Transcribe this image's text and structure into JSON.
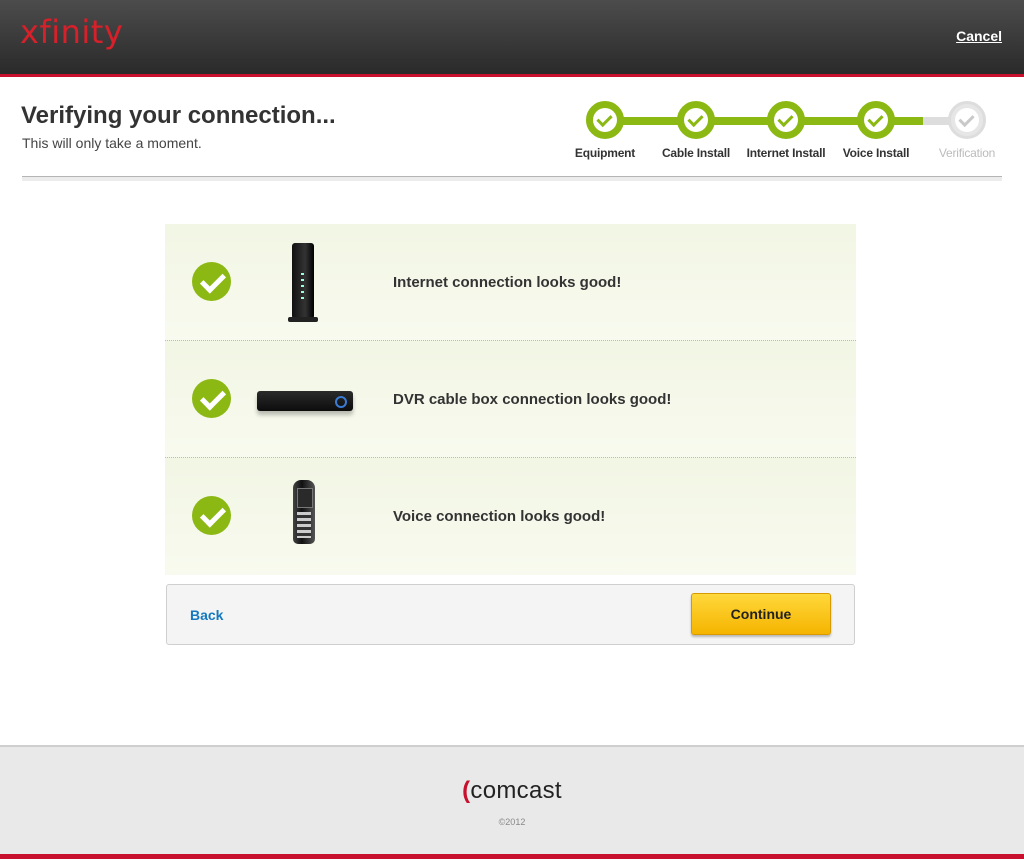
{
  "header": {
    "logo_text": "xfinity",
    "cancel_label": "Cancel"
  },
  "page": {
    "title": "Verifying your connection...",
    "subtitle": "This will only take a moment."
  },
  "progress": {
    "steps": [
      {
        "label": "Equipment",
        "status": "complete"
      },
      {
        "label": "Cable Install",
        "status": "complete"
      },
      {
        "label": "Internet Install",
        "status": "complete"
      },
      {
        "label": "Voice Install",
        "status": "complete"
      },
      {
        "label": "Verification",
        "status": "pending"
      }
    ]
  },
  "checks": [
    {
      "device_icon": "modem-icon",
      "message": "Internet connection looks good!"
    },
    {
      "device_icon": "dvr-box-icon",
      "message": "DVR cable box connection looks good!"
    },
    {
      "device_icon": "phone-icon",
      "message": "Voice connection looks good!"
    }
  ],
  "actions": {
    "back_label": "Back",
    "continue_label": "Continue"
  },
  "footer": {
    "brand": "comcast",
    "copyright": "©2012"
  },
  "colors": {
    "brand_red": "#c8102e",
    "check_green": "#8bb813",
    "link_blue": "#1479c0",
    "button_yellow": "#f5b400"
  }
}
